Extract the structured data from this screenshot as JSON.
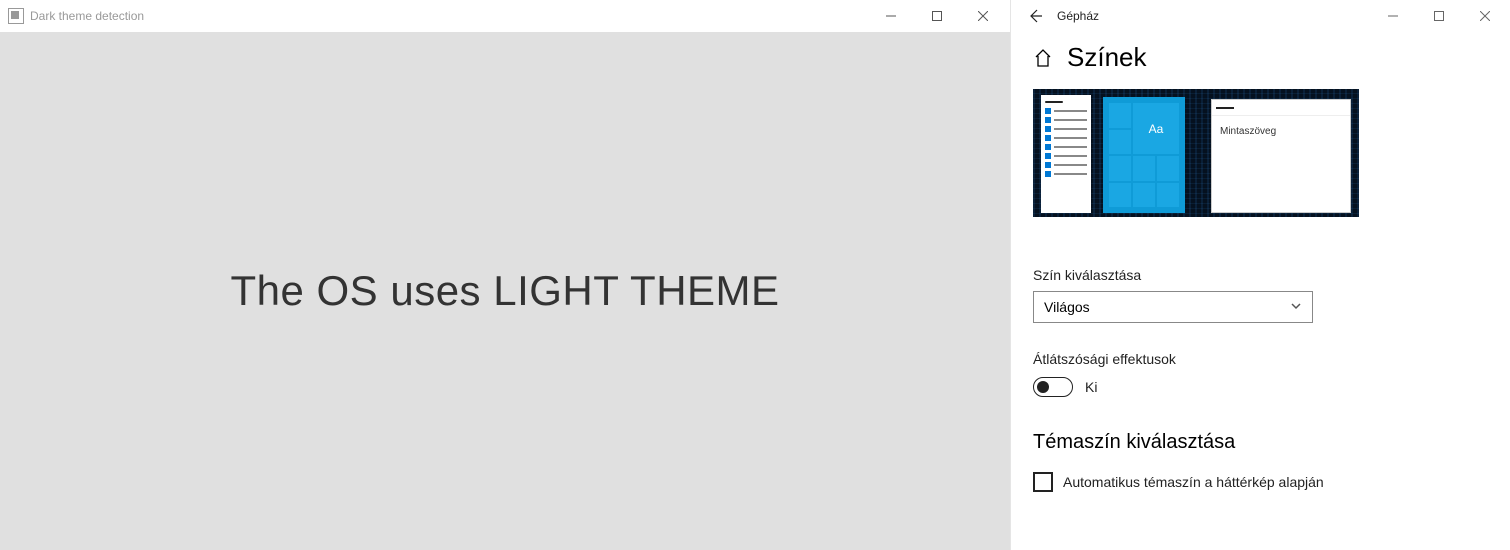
{
  "app": {
    "title": "Dark theme detection",
    "main_text": "The OS uses LIGHT THEME"
  },
  "settings": {
    "window_title": "Gépház",
    "page_header": "Színek",
    "preview": {
      "tile_label": "Aa",
      "sample_text": "Mintaszöveg"
    },
    "color_select_label": "Szín kiválasztása",
    "color_select_value": "Világos",
    "transparency_label": "Átlátszósági effektusok",
    "transparency_state": "Ki",
    "accent_header": "Témaszín kiválasztása",
    "auto_accent_label": "Automatikus témaszín a háttérkép alapján"
  }
}
